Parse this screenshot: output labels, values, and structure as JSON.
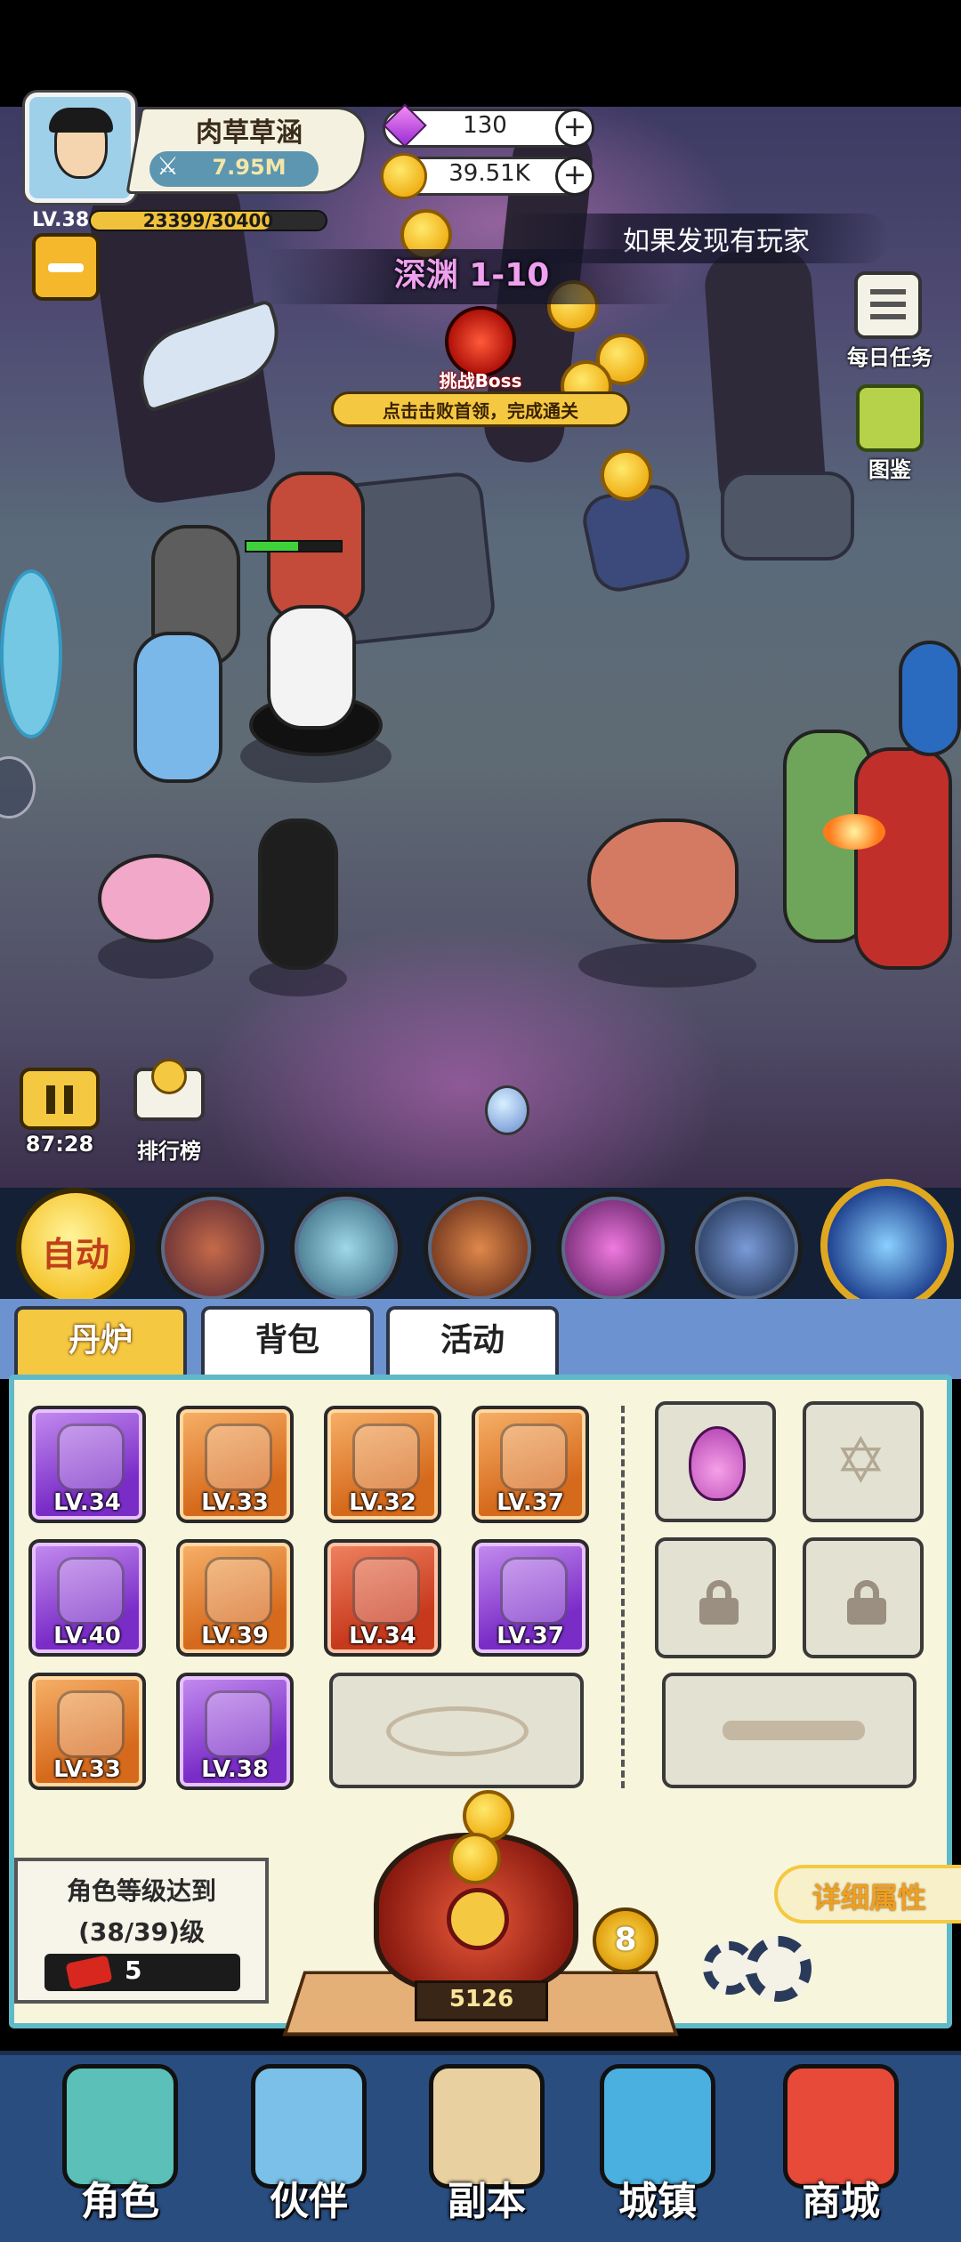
{
  "player": {
    "name": "肉草草涵",
    "power": "7.95M",
    "level": "LV.38",
    "exp": "23399/30400",
    "exp_progress": 0.77
  },
  "currency": {
    "gems": "130",
    "gold": "39.51K"
  },
  "stage": {
    "title": "深渊 1-10",
    "boss_label": "挑战Boss",
    "hint": "点击击败首领，完成通关"
  },
  "marquee": "如果发现有玩家",
  "right_menu": {
    "daily_tasks": "每日任务",
    "codex": "图鉴"
  },
  "battle": {
    "timer": "87:28",
    "ranking": "排行榜",
    "enemy_hp_progress": 0.6
  },
  "skills": {
    "auto_label": "自动"
  },
  "tabs": [
    {
      "label": "丹炉",
      "active": true
    },
    {
      "label": "背包",
      "active": false
    },
    {
      "label": "活动",
      "active": false
    }
  ],
  "equipment": [
    {
      "level": "LV.34",
      "rarity": "purple",
      "icon": "spear-icon"
    },
    {
      "level": "LV.33",
      "rarity": "orange",
      "icon": "scroll-icon"
    },
    {
      "level": "LV.32",
      "rarity": "orange",
      "icon": "crystal-armor-icon"
    },
    {
      "level": "LV.37",
      "rarity": "orange",
      "icon": "phoenix-orb-icon"
    },
    {
      "level": "LV.40",
      "rarity": "purple",
      "icon": "sword-icon"
    },
    {
      "level": "LV.39",
      "rarity": "orange",
      "icon": "shield-icon"
    },
    {
      "level": "LV.34",
      "rarity": "red",
      "icon": "necklace-icon"
    },
    {
      "level": "LV.37",
      "rarity": "purple",
      "icon": "red-orb-icon"
    },
    {
      "level": "LV.33",
      "rarity": "orange",
      "icon": "bracelet-icon"
    },
    {
      "level": "LV.38",
      "rarity": "purple",
      "icon": "boots-icon"
    }
  ],
  "furnace": {
    "requirement_title": "角色等级达到",
    "requirement_value": "(38/39)级",
    "ticket_count": "5",
    "furnace_level": "5126",
    "pending_count": "8",
    "detail_button": "详细属性"
  },
  "nav": [
    {
      "label": "角色",
      "icon": "character-icon"
    },
    {
      "label": "伙伴",
      "icon": "partner-icon"
    },
    {
      "label": "副本",
      "icon": "dungeon-icon"
    },
    {
      "label": "城镇",
      "icon": "town-icon"
    },
    {
      "label": "商城",
      "icon": "shop-icon"
    }
  ],
  "colors": {
    "accent_gold": "#f5c842",
    "panel_bg": "#f7f5dc",
    "nav_bg": "#2a4d7f",
    "exp_bar": "#f0c13b"
  }
}
